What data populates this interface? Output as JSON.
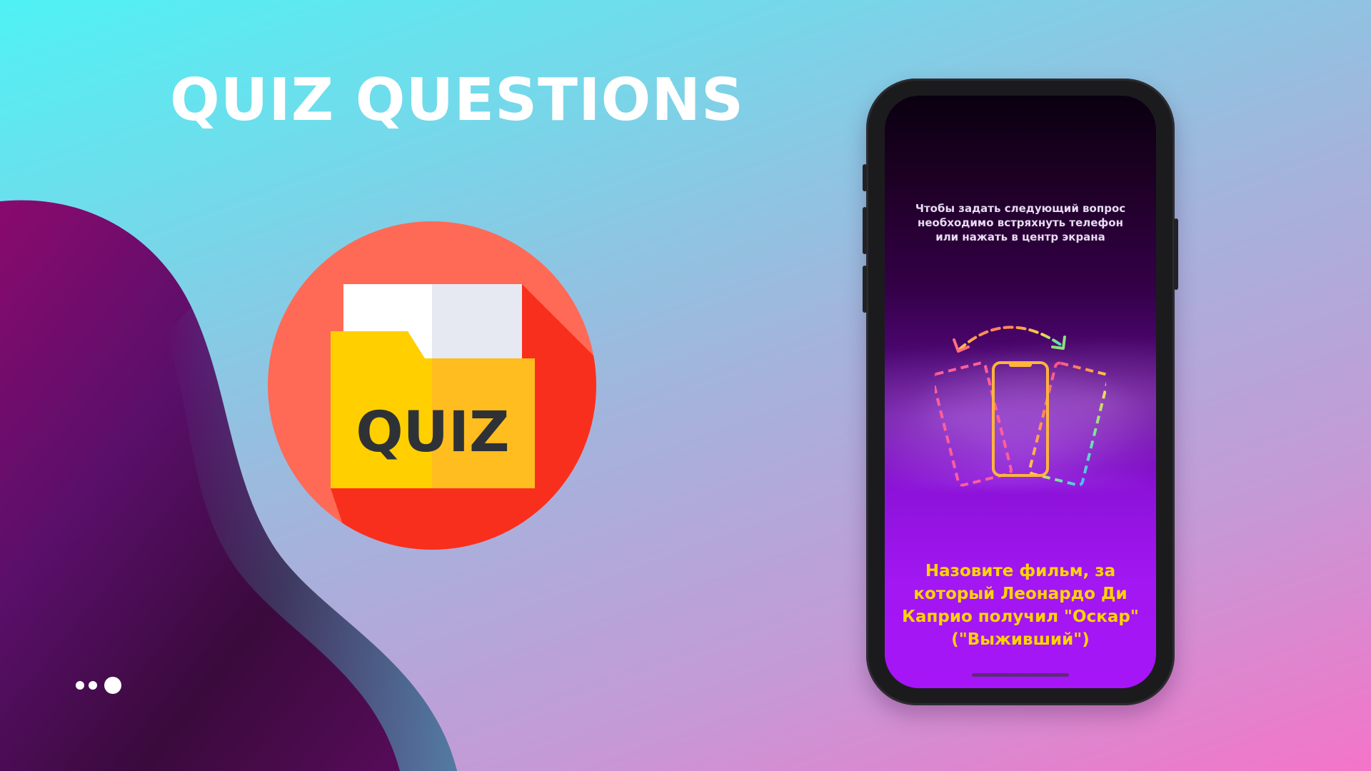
{
  "slide": {
    "title": "QUIZ QUESTIONS"
  },
  "logo": {
    "label": "QUIZ",
    "icon": "quiz-folder-icon",
    "colors": {
      "circle": "#ff6a57",
      "shadow": "#f92f1d",
      "folder": "#ffcf00",
      "folder_shade": "#ffbd1f",
      "paper": "#ffffff",
      "paper_shade": "#e6e9f2",
      "label": "#2e3237"
    }
  },
  "brand": {
    "icon": "dots-logo-icon"
  },
  "phone": {
    "hint": "Чтобы задать следующий вопрос необходимо встряхнуть телефон или нажать в центр экрана",
    "illustration_icon": "shake-phone-icon",
    "question": "Назовите фильм, за который Леонардо Ди Каприо получил \"Оскар\" (\"Выживший\")",
    "colors": {
      "question": "#ffd400",
      "hint": "#e6dcf0"
    }
  }
}
